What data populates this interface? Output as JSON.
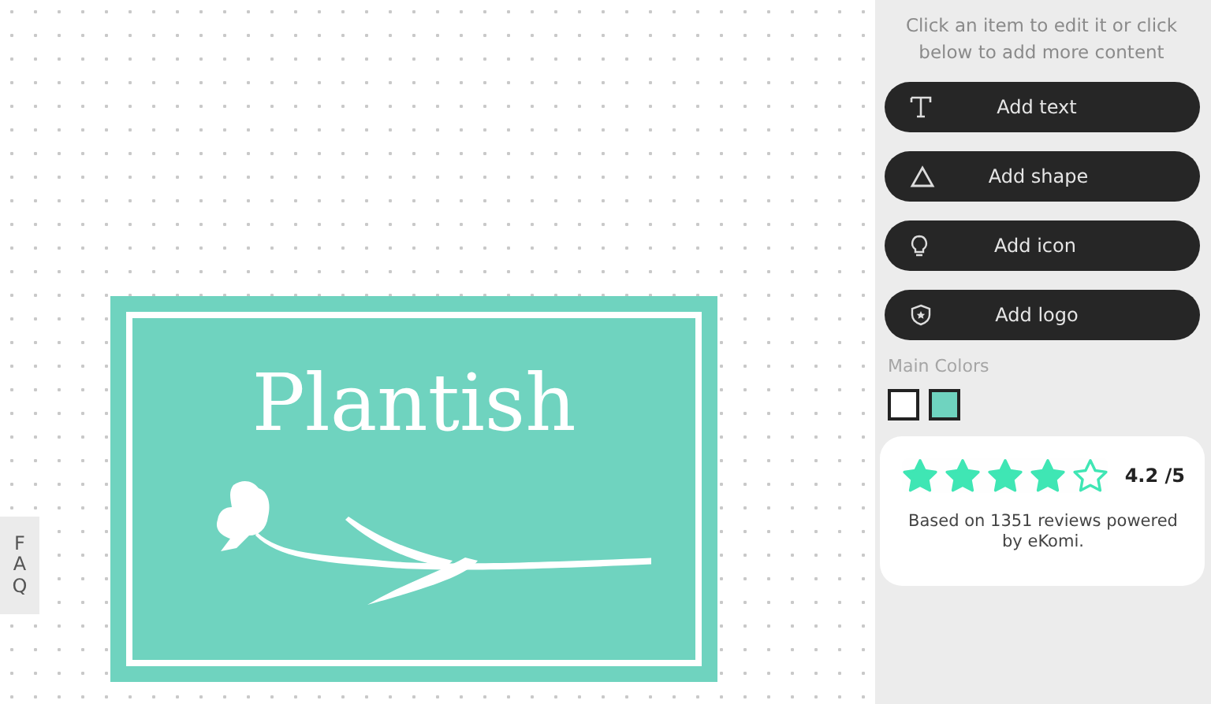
{
  "canvas": {
    "logo": {
      "name": "Plantish"
    },
    "faq": "FAQ"
  },
  "sidebar": {
    "hint": "Click an item to edit it or click below to add more content",
    "buttons": [
      {
        "label": "Add text",
        "kind": "text"
      },
      {
        "label": "Add shape",
        "kind": "shape"
      },
      {
        "label": "Add icon",
        "kind": "icon"
      },
      {
        "label": "Add logo",
        "kind": "logo"
      }
    ],
    "main_colors": {
      "label": "Main Colors",
      "swatches": [
        {
          "color": "#ffffff"
        },
        {
          "color": "#6fd3bf"
        }
      ]
    },
    "rating": {
      "stars": 4,
      "score": "4.2 /5",
      "note": "Based on 1351 reviews powered by eKomi."
    }
  }
}
